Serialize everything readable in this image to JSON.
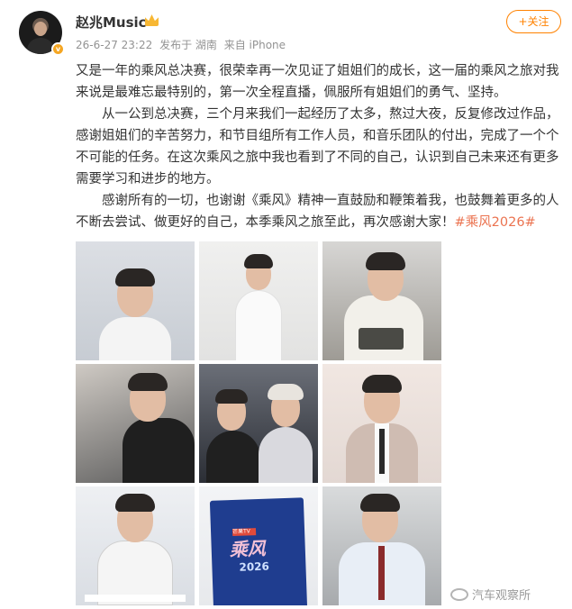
{
  "author": {
    "name": "赵兆Music",
    "verified_badge": "v",
    "crown_icon": "vip-crown-icon"
  },
  "meta": {
    "timestamp": "26-6-27 23:22",
    "source": "发布于 湖南",
    "device": "来自 iPhone"
  },
  "follow_button": {
    "label": "+关注",
    "color": "#ff8200"
  },
  "post": {
    "paragraph1": "又是一年的乘风总决赛，很荣幸再一次见证了姐姐们的成长，这一届的乘风之旅对我来说是最难忘最特别的，第一次全程直播，佩服所有姐姐们的勇气、坚持。",
    "paragraph2": "从一公到总决赛，三个月来我们一起经历了太多，熬过大夜，反复修改过作品，感谢姐姐们的辛苦努力，和节目组所有工作人员，和音乐团队的付出，完成了一个个不可能的任务。在这次乘风之旅中我也看到了不同的自己，认识到自己未来还有更多需要学习和进步的地方。",
    "paragraph3": "感谢所有的一切，也谢谢《乘风》精神一直鼓励和鞭策着我，也鼓舞着更多的人不断去尝试、做更好的自己，本季乘风之旅至此，再次感谢大家！",
    "hashtag": "#乘风2026#",
    "hashtag_color": "#eb7350"
  },
  "photos": {
    "book_logo": "芒果TV",
    "book_title": "乘风",
    "book_year": "2026"
  },
  "watermark": {
    "text": "汽车观察所",
    "icon": "weibo-icon"
  }
}
